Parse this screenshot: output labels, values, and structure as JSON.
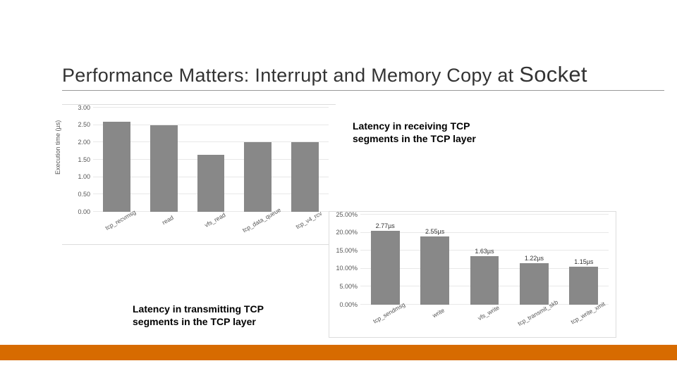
{
  "title_main": "Performance Matters: Interrupt and Memory Copy at ",
  "title_emph": "Socket",
  "caption1": "Latency in receiving TCP segments in the TCP layer",
  "caption2": "Latency in transmitting TCP segments in the TCP layer",
  "chart_data": [
    {
      "type": "bar",
      "title": "",
      "ylabel": "Execution time (µs)",
      "xlabel": "",
      "ylim": [
        0,
        3.0
      ],
      "yticks": [
        "0.00",
        "0.50",
        "1.00",
        "1.50",
        "2.00",
        "2.50",
        "3.00"
      ],
      "categories": [
        "tcp_recvmsg",
        "read",
        "vfs_read",
        "tcp_data_queue",
        "tcp_v4_rcv"
      ],
      "values": [
        2.6,
        2.5,
        1.65,
        2.0,
        2.0
      ],
      "show_values": false
    },
    {
      "type": "bar",
      "title": "",
      "ylabel": "",
      "xlabel": "",
      "ylim": [
        0,
        25
      ],
      "yticks": [
        "0.00%",
        "5.00%",
        "10.00%",
        "15.00%",
        "20.00%",
        "25.00%"
      ],
      "categories": [
        "tcp_sendmsg",
        "write",
        "vfs_write",
        "tcp_transmit_skb",
        "tcp_write_xmit"
      ],
      "values": [
        20.5,
        19.0,
        13.5,
        11.5,
        10.5
      ],
      "value_labels": [
        "2.77µs",
        "2.55µs",
        "1.63µs",
        "1.22µs",
        "1.15µs"
      ],
      "show_values": true
    }
  ]
}
